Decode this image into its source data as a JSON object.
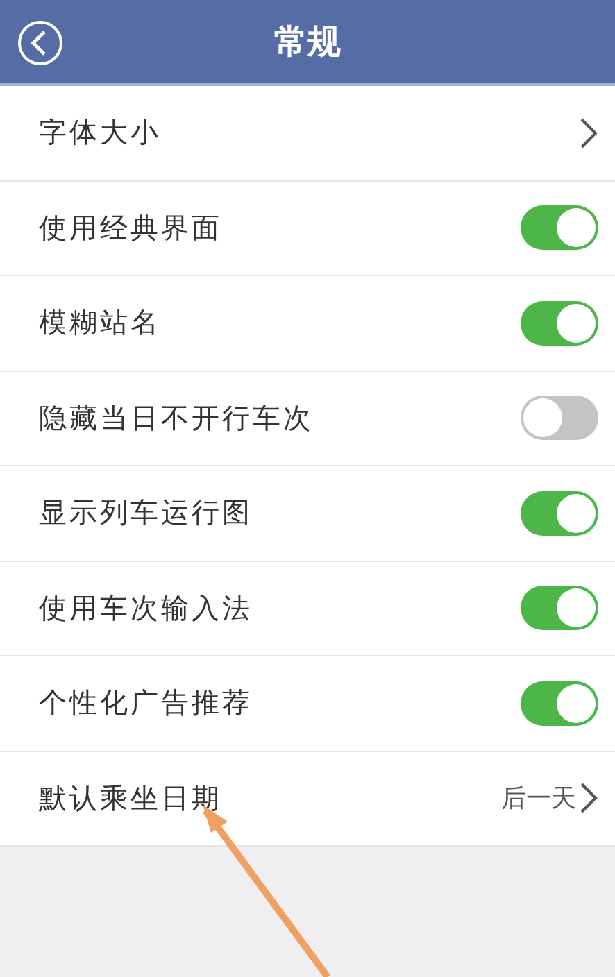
{
  "header": {
    "title": "常规"
  },
  "settings": [
    {
      "kind": "link",
      "label": "字体大小"
    },
    {
      "kind": "toggle",
      "label": "使用经典界面",
      "on": true
    },
    {
      "kind": "toggle",
      "label": "模糊站名",
      "on": true
    },
    {
      "kind": "toggle",
      "label": "隐藏当日不开行车次",
      "on": false
    },
    {
      "kind": "toggle",
      "label": "显示列车运行图",
      "on": true
    },
    {
      "kind": "toggle",
      "label": "使用车次输入法",
      "on": true
    },
    {
      "kind": "toggle",
      "label": "个性化广告推荐",
      "on": true
    },
    {
      "kind": "link",
      "label": "默认乘坐日期",
      "value": "后一天"
    }
  ]
}
